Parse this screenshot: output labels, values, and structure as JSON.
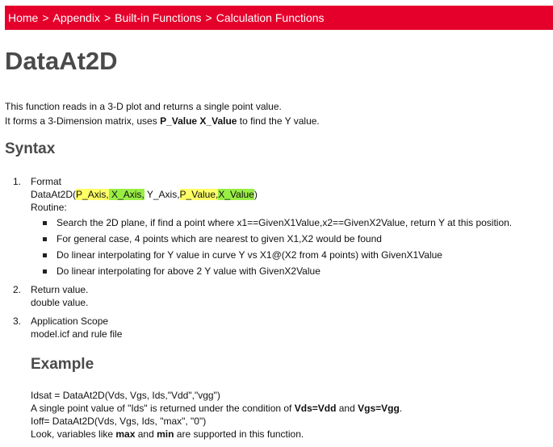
{
  "breadcrumb": {
    "items": [
      "Home",
      "Appendix",
      "Built-in Functions",
      "Calculation Functions"
    ],
    "separator": ">"
  },
  "page_title": "DataAt2D",
  "intro": {
    "line1": "This function reads in a 3-D plot and returns a single point value.",
    "line2_prefix": "It forms a 3-Dimension matrix, uses ",
    "line2_bold": "P_Value X_Value",
    "line2_suffix": " to find the Y value."
  },
  "syntax": {
    "title": "Syntax",
    "items": [
      {
        "num": "1.",
        "label": "Format",
        "call": {
          "fn": "DataAt2D(",
          "p_axis": "P_Axis,",
          "x_axis": " X_Axis,",
          "y_axis": " Y_Axis,",
          "p_value": "P_Value,",
          "x_value": "X_Value",
          "close": ")"
        },
        "routine_label": "Routine:",
        "routine": [
          "Search the 2D plane, if find a point where x1==GivenX1Value,x2==GivenX2Value, return Y at this position.",
          "For general case, 4 points which are nearest to given X1,X2 would be found",
          "Do linear interpolating for Y value in curve Y vs X1@(X2 from 4 points) with GivenX1Value",
          "Do linear interpolating for above 2 Y value with GivenX2Value"
        ]
      },
      {
        "num": "2.",
        "label": "Return value.",
        "detail": "double value."
      },
      {
        "num": "3.",
        "label": "Application Scope",
        "detail": "model.icf and rule file"
      }
    ]
  },
  "example": {
    "title": "Example",
    "line1": "Idsat = DataAt2D(Vds, Vgs, Ids,\"Vdd\",\"vgg\")",
    "line2_prefix": "A single point value of \"Ids\" is returned under the condition of ",
    "line2_bold1": "Vds=Vdd",
    "line2_mid": " and ",
    "line2_bold2": "Vgs=Vgg",
    "line2_suffix": ".",
    "line3": "Ioff= DataAt2D(Vds, Vgs, Ids, \"max\", \"0\")",
    "line4_prefix": "Look, variables like ",
    "line4_bold1": "max",
    "line4_mid": " and ",
    "line4_bold2": "min",
    "line4_suffix": " are supported in this function."
  },
  "colors": {
    "breadcrumb_bg": "#e5002b",
    "heading": "#4a4a4a",
    "highlight_yellow": "#ffff66",
    "highlight_green": "#99ee44"
  }
}
